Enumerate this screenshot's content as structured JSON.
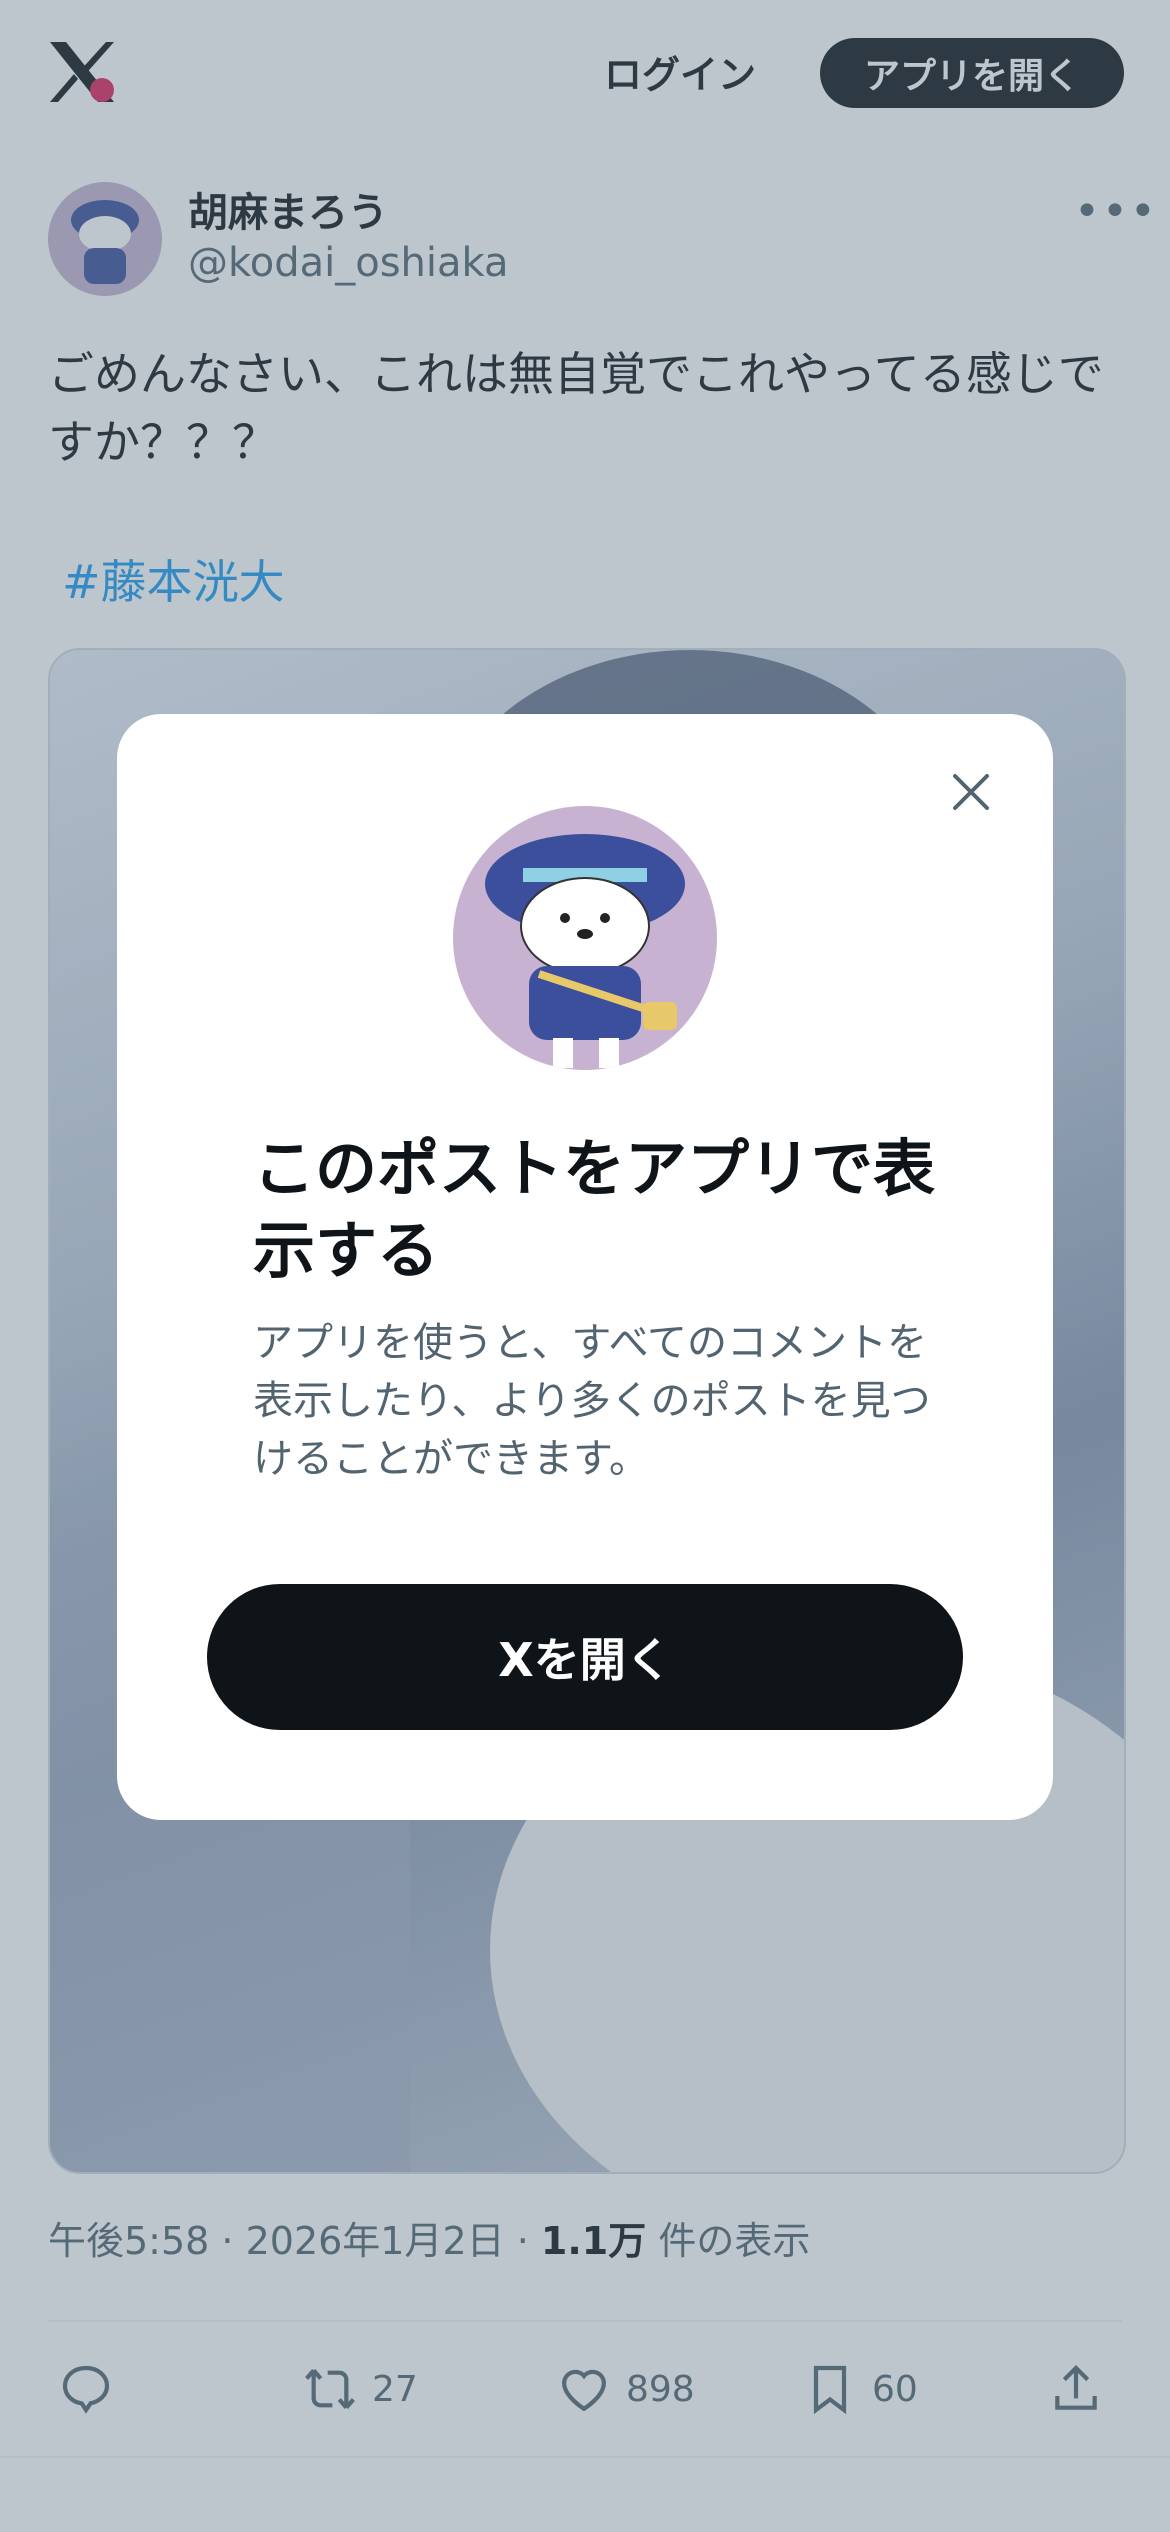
{
  "header": {
    "logo_icon": "x-logo-icon",
    "login_label": "ログイン",
    "open_app_label": "アプリを開く"
  },
  "post": {
    "author_name": "胡麻まろう",
    "author_handle": "@kodai_oshiaka",
    "more_icon": "more-icon",
    "text": "ごめんなさい、これは無自覚でこれやってる感じですか？？？",
    "hashtag": "#藤本洸大",
    "meta": {
      "time": "午後5:58",
      "sep1": " · ",
      "date": "2026年1月2日",
      "sep2": " · ",
      "views": "1.1万",
      "views_suffix": " 件の表示"
    },
    "actions": {
      "reply_icon": "reply-icon",
      "retweet_icon": "retweet-icon",
      "retweet_count": "27",
      "like_icon": "heart-icon",
      "like_count": "898",
      "bookmark_icon": "bookmark-icon",
      "bookmark_count": "60",
      "share_icon": "share-icon"
    }
  },
  "modal": {
    "close_icon": "close-icon",
    "title": "このポストをアプリで表示する",
    "description": "アプリを使うと、すべてのコメントを表示したり、より多くのポストを見つけることができます。",
    "button_label": "Xを開く"
  },
  "colors": {
    "text": "#0f1419",
    "secondary": "#536471",
    "link": "#1d9bf0",
    "overlay": "rgba(91,112,131,0.40)"
  }
}
